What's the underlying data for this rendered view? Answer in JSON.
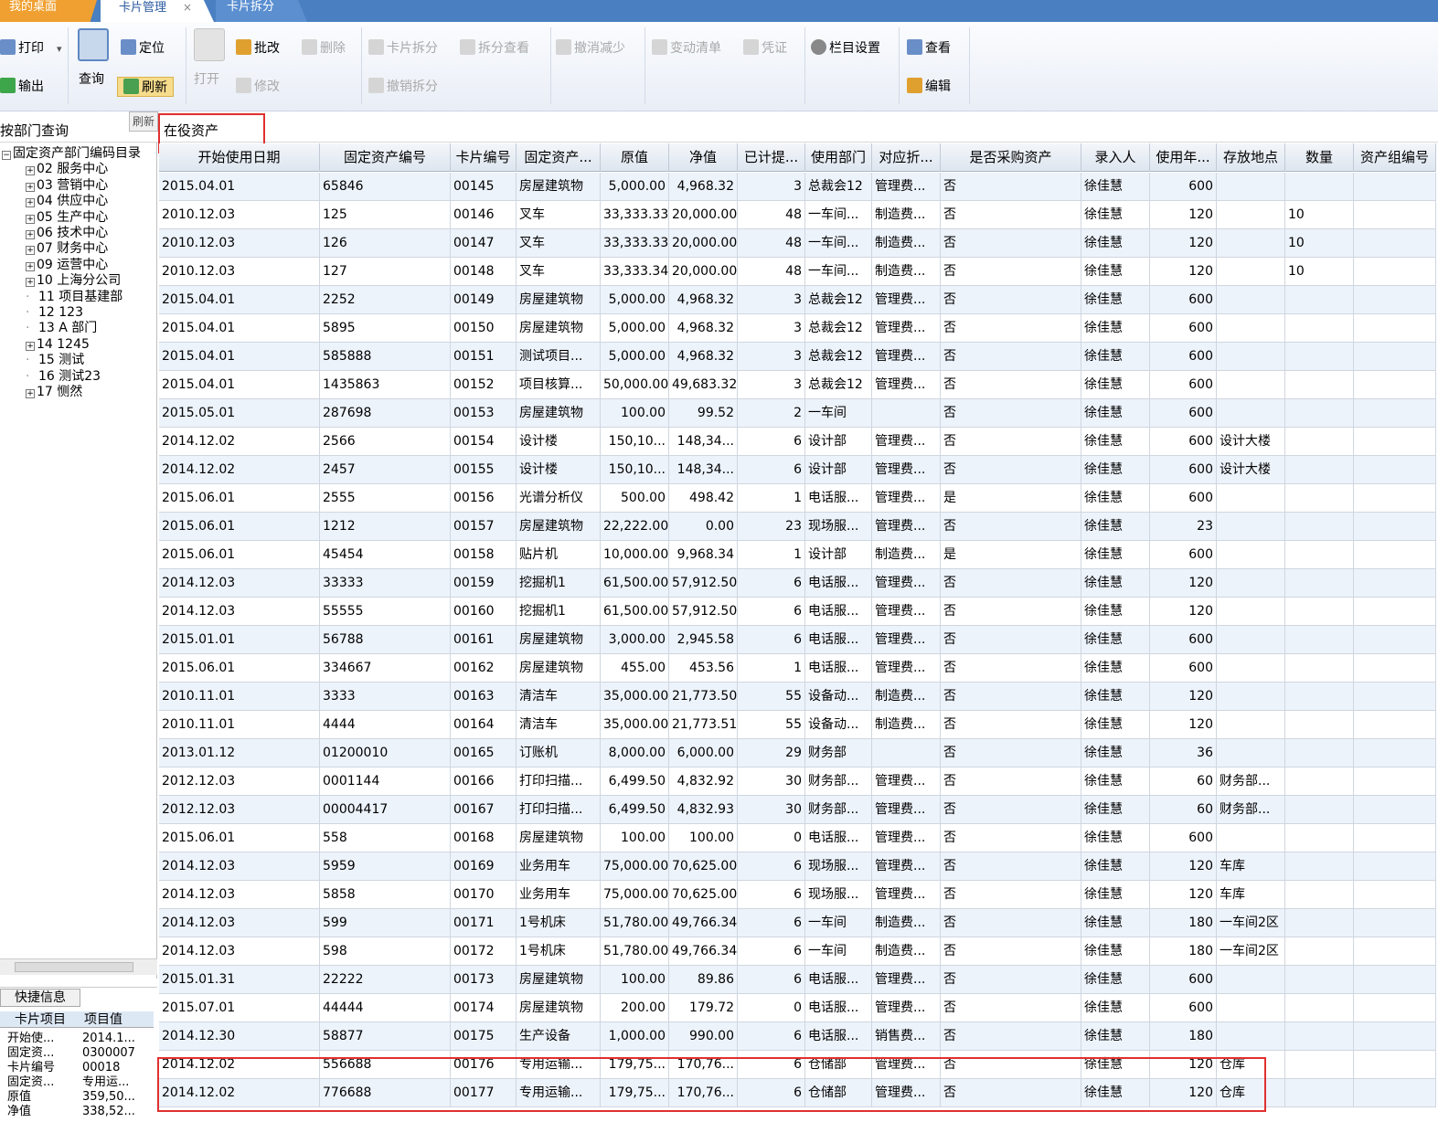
{
  "tabs": {
    "home": "我的桌面",
    "active": "卡片管理",
    "other": "卡片拆分",
    "close": "×"
  },
  "toolbar": {
    "print": "打印",
    "print_dropdown": "▾",
    "export": "输出",
    "query": "查询",
    "locate": "定位",
    "refresh": "刷新",
    "open": "打开",
    "approve": "批改",
    "edit": "修改",
    "delete": "删除",
    "split": "卡片拆分",
    "split_view": "拆分查看",
    "cancel_split": "撤销拆分",
    "cancel_reduce": "撤消减少",
    "change_list": "变动清单",
    "voucher": "凭证",
    "column_settings": "栏目设置",
    "view": "查看",
    "edit2": "编辑"
  },
  "filter": {
    "dept_query": "按部门查询",
    "tooltip": "刷新",
    "status": "在役资产"
  },
  "tree": {
    "root": "固定资产部门编码目录",
    "items": [
      {
        "label": "02 服务中心",
        "expandable": true
      },
      {
        "label": "03 营销中心",
        "expandable": true
      },
      {
        "label": "04 供应中心",
        "expandable": true
      },
      {
        "label": "05 生产中心",
        "expandable": true
      },
      {
        "label": "06 技术中心",
        "expandable": true
      },
      {
        "label": "07 财务中心",
        "expandable": true
      },
      {
        "label": "09 运营中心",
        "expandable": true
      },
      {
        "label": "10 上海分公司",
        "expandable": true
      },
      {
        "label": "11 项目基建部",
        "expandable": false
      },
      {
        "label": "12 123",
        "expandable": false
      },
      {
        "label": "13 A 部门",
        "expandable": false
      },
      {
        "label": "14 1245",
        "expandable": true
      },
      {
        "label": "15 测试",
        "expandable": false
      },
      {
        "label": "16 测试23",
        "expandable": false
      },
      {
        "label": "17 恻然",
        "expandable": true
      }
    ]
  },
  "quick": {
    "tab": "快捷信息",
    "col1": "卡片项目",
    "col2": "项目值",
    "rows": [
      {
        "k": "开始使...",
        "v": "2014.1..."
      },
      {
        "k": "固定资...",
        "v": "0300007"
      },
      {
        "k": "卡片编号",
        "v": "00018"
      },
      {
        "k": "固定资...",
        "v": "专用运..."
      },
      {
        "k": "原值",
        "v": "359,50..."
      },
      {
        "k": "净值",
        "v": "338,52..."
      }
    ]
  },
  "table": {
    "headers": [
      "开始使用日期",
      "固定资产编号",
      "卡片编号",
      "固定资产...",
      "原值",
      "净值",
      "已计提...",
      "使用部门",
      "对应折...",
      "是否采购资产",
      "录入人",
      "使用年...",
      "存放地点",
      "数量",
      "资产组编号"
    ],
    "rows": [
      [
        "2015.04.01",
        "65846",
        "00145",
        "房屋建筑物",
        "5,000.00",
        "4,968.32",
        "3",
        "总裁会12",
        "管理费...",
        "否",
        "徐佳慧",
        "600",
        "",
        ""
      ],
      [
        "2010.12.03",
        "125",
        "00146",
        "叉车",
        "33,333.33",
        "20,000.00",
        "48",
        "一车间...",
        "制造费...",
        "否",
        "徐佳慧",
        "120",
        "",
        "10"
      ],
      [
        "2010.12.03",
        "126",
        "00147",
        "叉车",
        "33,333.33",
        "20,000.00",
        "48",
        "一车间...",
        "制造费...",
        "否",
        "徐佳慧",
        "120",
        "",
        "10"
      ],
      [
        "2010.12.03",
        "127",
        "00148",
        "叉车",
        "33,333.34",
        "20,000.00",
        "48",
        "一车间...",
        "制造费...",
        "否",
        "徐佳慧",
        "120",
        "",
        "10"
      ],
      [
        "2015.04.01",
        "2252",
        "00149",
        "房屋建筑物",
        "5,000.00",
        "4,968.32",
        "3",
        "总裁会12",
        "管理费...",
        "否",
        "徐佳慧",
        "600",
        "",
        ""
      ],
      [
        "2015.04.01",
        "5895",
        "00150",
        "房屋建筑物",
        "5,000.00",
        "4,968.32",
        "3",
        "总裁会12",
        "管理费...",
        "否",
        "徐佳慧",
        "600",
        "",
        ""
      ],
      [
        "2015.04.01",
        "585888",
        "00151",
        "测试项目...",
        "5,000.00",
        "4,968.32",
        "3",
        "总裁会12",
        "管理费...",
        "否",
        "徐佳慧",
        "600",
        "",
        ""
      ],
      [
        "2015.04.01",
        "1435863",
        "00152",
        "项目核算...",
        "50,000.00",
        "49,683.32",
        "3",
        "总裁会12",
        "管理费...",
        "否",
        "徐佳慧",
        "600",
        "",
        ""
      ],
      [
        "2015.05.01",
        "287698",
        "00153",
        "房屋建筑物",
        "100.00",
        "99.52",
        "2",
        "一车间",
        "",
        "否",
        "徐佳慧",
        "600",
        "",
        ""
      ],
      [
        "2014.12.02",
        "2566",
        "00154",
        "设计楼",
        "150,10...",
        "148,34...",
        "6",
        "设计部",
        "管理费...",
        "否",
        "徐佳慧",
        "600",
        "设计大楼",
        ""
      ],
      [
        "2014.12.02",
        "2457",
        "00155",
        "设计楼",
        "150,10...",
        "148,34...",
        "6",
        "设计部",
        "管理费...",
        "否",
        "徐佳慧",
        "600",
        "设计大楼",
        ""
      ],
      [
        "2015.06.01",
        "2555",
        "00156",
        "光谱分析仪",
        "500.00",
        "498.42",
        "1",
        "电话服...",
        "管理费...",
        "是",
        "徐佳慧",
        "600",
        "",
        ""
      ],
      [
        "2015.06.01",
        "1212",
        "00157",
        "房屋建筑物",
        "22,222.00",
        "0.00",
        "23",
        "现场服...",
        "管理费...",
        "否",
        "徐佳慧",
        "23",
        "",
        ""
      ],
      [
        "2015.06.01",
        "45454",
        "00158",
        "贴片机",
        "10,000.00",
        "9,968.34",
        "1",
        "设计部",
        "制造费...",
        "是",
        "徐佳慧",
        "600",
        "",
        ""
      ],
      [
        "2014.12.03",
        "33333",
        "00159",
        "挖掘机1",
        "61,500.00",
        "57,912.50",
        "6",
        "电话服...",
        "管理费...",
        "否",
        "徐佳慧",
        "120",
        "",
        ""
      ],
      [
        "2014.12.03",
        "55555",
        "00160",
        "挖掘机1",
        "61,500.00",
        "57,912.50",
        "6",
        "电话服...",
        "管理费...",
        "否",
        "徐佳慧",
        "120",
        "",
        ""
      ],
      [
        "2015.01.01",
        "56788",
        "00161",
        "房屋建筑物",
        "3,000.00",
        "2,945.58",
        "6",
        "电话服...",
        "管理费...",
        "否",
        "徐佳慧",
        "600",
        "",
        ""
      ],
      [
        "2015.06.01",
        "334667",
        "00162",
        "房屋建筑物",
        "455.00",
        "453.56",
        "1",
        "电话服...",
        "管理费...",
        "否",
        "徐佳慧",
        "600",
        "",
        ""
      ],
      [
        "2010.11.01",
        "3333",
        "00163",
        "清洁车",
        "35,000.00",
        "21,773.50",
        "55",
        "设备动...",
        "制造费...",
        "否",
        "徐佳慧",
        "120",
        "",
        ""
      ],
      [
        "2010.11.01",
        "4444",
        "00164",
        "清洁车",
        "35,000.00",
        "21,773.51",
        "55",
        "设备动...",
        "制造费...",
        "否",
        "徐佳慧",
        "120",
        "",
        ""
      ],
      [
        "2013.01.12",
        "01200010",
        "00165",
        "订账机",
        "8,000.00",
        "6,000.00",
        "29",
        "财务部",
        "",
        "否",
        "徐佳慧",
        "36",
        "",
        ""
      ],
      [
        "2012.12.03",
        "0001144",
        "00166",
        "打印扫描...",
        "6,499.50",
        "4,832.92",
        "30",
        "财务部...",
        "管理费...",
        "否",
        "徐佳慧",
        "60",
        "财务部...",
        ""
      ],
      [
        "2012.12.03",
        "00004417",
        "00167",
        "打印扫描...",
        "6,499.50",
        "4,832.93",
        "30",
        "财务部...",
        "管理费...",
        "否",
        "徐佳慧",
        "60",
        "财务部...",
        ""
      ],
      [
        "2015.06.01",
        "558",
        "00168",
        "房屋建筑物",
        "100.00",
        "100.00",
        "0",
        "电话服...",
        "管理费...",
        "否",
        "徐佳慧",
        "600",
        "",
        ""
      ],
      [
        "2014.12.03",
        "5959",
        "00169",
        "业务用车",
        "75,000.00",
        "70,625.00",
        "6",
        "现场服...",
        "管理费...",
        "否",
        "徐佳慧",
        "120",
        "车库",
        ""
      ],
      [
        "2014.12.03",
        "5858",
        "00170",
        "业务用车",
        "75,000.00",
        "70,625.00",
        "6",
        "现场服...",
        "管理费...",
        "否",
        "徐佳慧",
        "120",
        "车库",
        ""
      ],
      [
        "2014.12.03",
        "599",
        "00171",
        "1号机床",
        "51,780.00",
        "49,766.34",
        "6",
        "一车间",
        "制造费...",
        "否",
        "徐佳慧",
        "180",
        "一车间2区",
        ""
      ],
      [
        "2014.12.03",
        "598",
        "00172",
        "1号机床",
        "51,780.00",
        "49,766.34",
        "6",
        "一车间",
        "制造费...",
        "否",
        "徐佳慧",
        "180",
        "一车间2区",
        ""
      ],
      [
        "2015.01.31",
        "22222",
        "00173",
        "房屋建筑物",
        "100.00",
        "89.86",
        "6",
        "电话服...",
        "管理费...",
        "否",
        "徐佳慧",
        "600",
        "",
        ""
      ],
      [
        "2015.07.01",
        "44444",
        "00174",
        "房屋建筑物",
        "200.00",
        "179.72",
        "0",
        "电话服...",
        "管理费...",
        "否",
        "徐佳慧",
        "600",
        "",
        ""
      ],
      [
        "2014.12.30",
        "58877",
        "00175",
        "生产设备",
        "1,000.00",
        "990.00",
        "6",
        "电话服...",
        "销售费...",
        "否",
        "徐佳慧",
        "180",
        "",
        ""
      ],
      [
        "2014.12.02",
        "556688",
        "00176",
        "专用运输...",
        "179,75...",
        "170,76...",
        "6",
        "仓储部",
        "管理费...",
        "否",
        "徐佳慧",
        "120",
        "仓库",
        ""
      ],
      [
        "2014.12.02",
        "776688",
        "00177",
        "专用运输...",
        "179,75...",
        "170,76...",
        "6",
        "仓储部",
        "管理费...",
        "否",
        "徐佳慧",
        "120",
        "仓库",
        ""
      ]
    ]
  },
  "colors": {
    "highlight": "#e03030",
    "tabbar": "#4a7fc1",
    "home_tab": "#f0a030"
  }
}
